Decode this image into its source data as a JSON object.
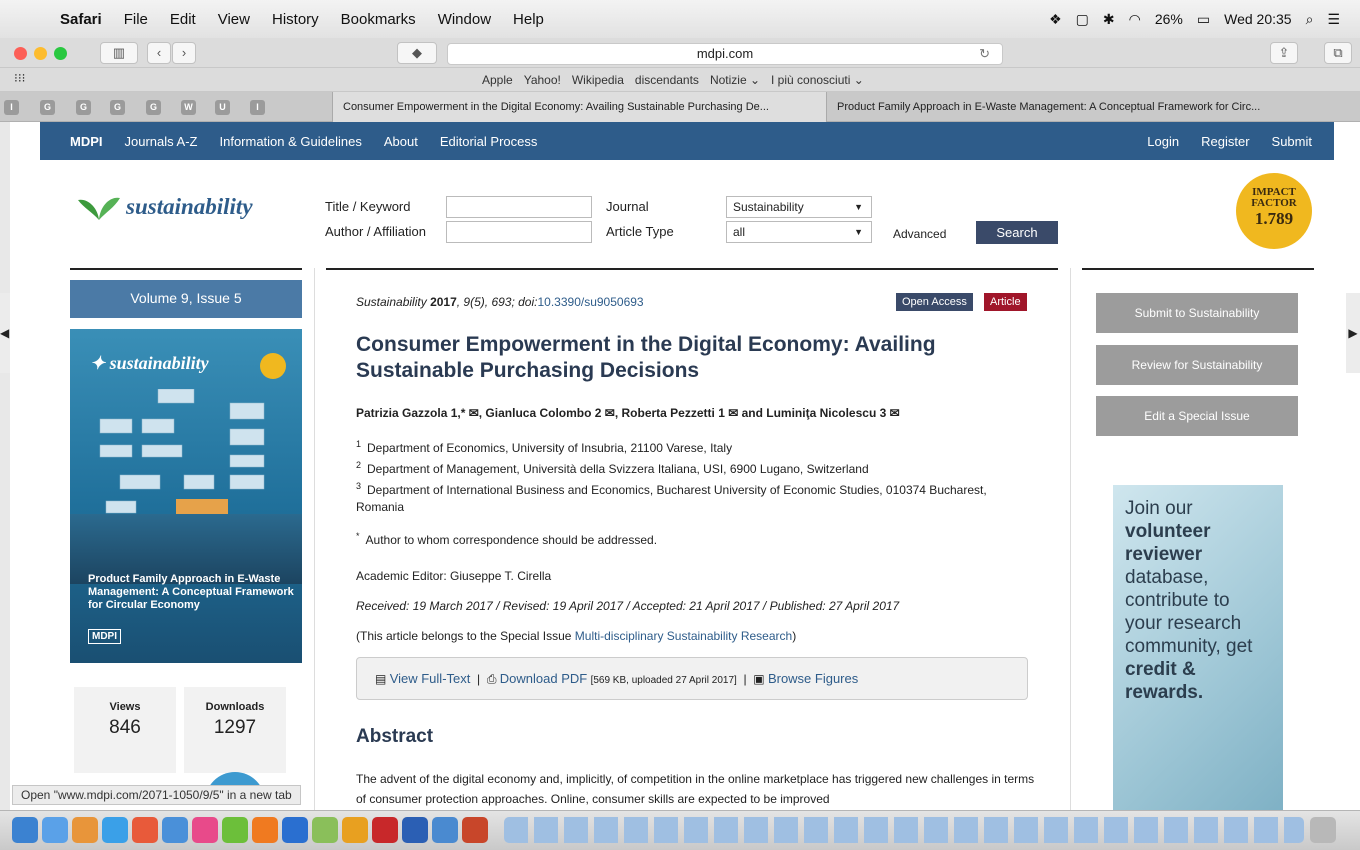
{
  "menubar": {
    "app": "Safari",
    "items": [
      "File",
      "Edit",
      "View",
      "History",
      "Bookmarks",
      "Window",
      "Help"
    ],
    "battery": "26%",
    "clock": "Wed 20:35"
  },
  "browser": {
    "url": "mdpi.com",
    "favorites": [
      "Apple",
      "Yahoo!",
      "Wikipedia",
      "discendants",
      "Notizie ⌄",
      "I più conosciuti ⌄"
    ],
    "tabs": [
      "Consumer Empowerment in the Digital Economy: Availing Sustainable Purchasing De...",
      "Product Family Approach in E-Waste Management: A Conceptual Framework for Circ..."
    ],
    "status": "Open \"www.mdpi.com/2071-1050/9/5\" in a new tab"
  },
  "nav": {
    "left": [
      "MDPI",
      "Journals A-Z",
      "Information & Guidelines",
      "About",
      "Editorial Process"
    ],
    "right": [
      "Login",
      "Register",
      "Submit"
    ]
  },
  "header": {
    "journal_logo": "sustainability",
    "impact": {
      "line1": "IMPACT",
      "line2": "FACTOR",
      "value": "1.789"
    },
    "search": {
      "title_label": "Title / Keyword",
      "author_label": "Author / Affiliation",
      "journal_label": "Journal",
      "journal_value": "Sustainability",
      "type_label": "Article Type",
      "type_value": "all",
      "advanced": "Advanced",
      "button": "Search"
    }
  },
  "left": {
    "volume": "Volume 9, Issue 5",
    "cover": {
      "logo": "sustainability",
      "title": "Product Family Approach in E-Waste Management: A Conceptual Framework for Circular Economy",
      "publisher": "MDPI"
    },
    "views_label": "Views",
    "views": "846",
    "downloads_label": "Downloads",
    "downloads": "1297"
  },
  "article": {
    "meta_journal": "Sustainability",
    "meta_year": "2017",
    "meta_rest": ", 9(5), 693; doi:",
    "doi": "10.3390/su9050693",
    "badge_oa": "Open Access",
    "badge_type": "Article",
    "title": "Consumer Empowerment in the Digital Economy: Availing Sustainable Purchasing Decisions",
    "authors": "Patrizia Gazzola 1,* ✉, Gianluca Colombo 2 ✉, Roberta Pezzetti 1 ✉ and Luminiţa Nicolescu 3 ✉",
    "affiliations": [
      {
        "n": "1",
        "text": "Department of Economics, University of Insubria, 21100 Varese, Italy"
      },
      {
        "n": "2",
        "text": "Department of Management, Università della Svizzera Italiana, USI, 6900 Lugano, Switzerland"
      },
      {
        "n": "3",
        "text": "Department of International Business and Economics, Bucharest University of Economic Studies, 010374 Bucharest, Romania"
      }
    ],
    "corresp": "Author to whom correspondence should be addressed.",
    "editor": "Academic Editor: Giuseppe T. Cirella",
    "dates": "Received: 19 March 2017 / Revised: 19 April 2017 / Accepted: 21 April 2017 / Published: 27 April 2017",
    "special_prefix": "(This article belongs to the Special Issue ",
    "special_link": "Multi-disciplinary Sustainability Research",
    "special_suffix": ")",
    "full_text": "View Full-Text",
    "download_pdf": "Download PDF",
    "pdf_info": "[569 KB, uploaded 27 April 2017]",
    "browse_figures": "Browse Figures",
    "abstract_heading": "Abstract",
    "abstract": "The advent of the digital economy and, implicitly, of competition in the online marketplace has triggered new challenges in terms of consumer protection approaches. Online, consumer skills are expected to be improved"
  },
  "right": {
    "submit": "Submit to Sustainability",
    "review": "Review for Sustainability",
    "special": "Edit a Special Issue",
    "ad_line1": "Join our",
    "ad_bold1": "volunteer reviewer",
    "ad_line2": "database, contribute to your research community, get",
    "ad_bold2": "credit & rewards."
  }
}
